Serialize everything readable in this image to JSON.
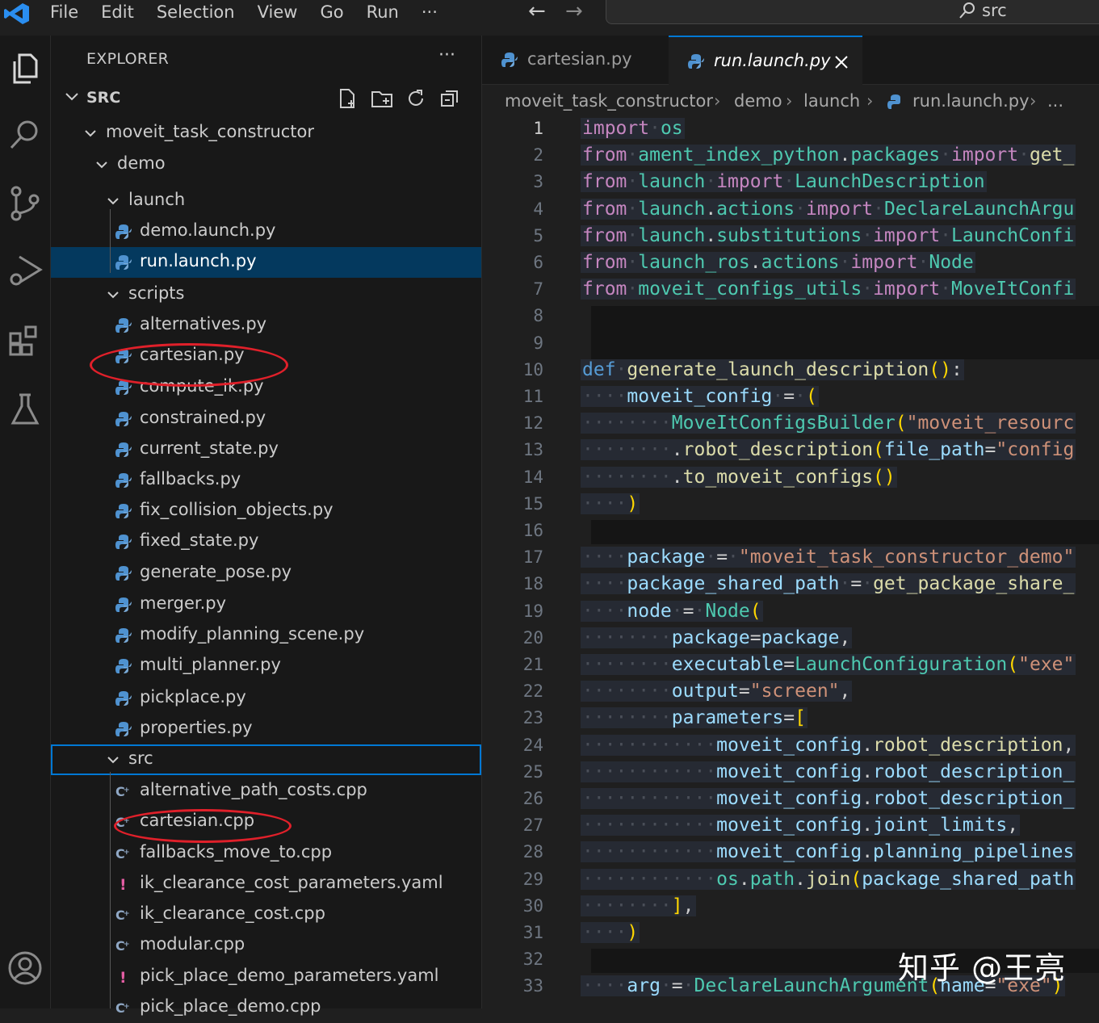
{
  "menu": [
    "File",
    "Edit",
    "Selection",
    "View",
    "Go",
    "Run",
    "···"
  ],
  "command_center": {
    "search_text": "src"
  },
  "activity_icons": [
    "explorer-icon",
    "search-icon",
    "source-control-icon",
    "run-debug-icon",
    "extensions-icon",
    "testing-icon",
    "accounts-icon"
  ],
  "explorer": {
    "title": "EXPLORER",
    "more": "···",
    "root": "SRC",
    "tree": [
      {
        "label": "moveit_task_constructor",
        "type": "folder"
      },
      {
        "label": "demo",
        "type": "folder"
      },
      {
        "label": "launch",
        "type": "folder"
      },
      {
        "label": "demo.launch.py",
        "type": "py"
      },
      {
        "label": "run.launch.py",
        "type": "py",
        "selected": true
      },
      {
        "label": "scripts",
        "type": "folder"
      },
      {
        "label": "alternatives.py",
        "type": "py"
      },
      {
        "label": "cartesian.py",
        "type": "py",
        "circled": true
      },
      {
        "label": "compute_ik.py",
        "type": "py"
      },
      {
        "label": "constrained.py",
        "type": "py"
      },
      {
        "label": "current_state.py",
        "type": "py"
      },
      {
        "label": "fallbacks.py",
        "type": "py"
      },
      {
        "label": "fix_collision_objects.py",
        "type": "py"
      },
      {
        "label": "fixed_state.py",
        "type": "py"
      },
      {
        "label": "generate_pose.py",
        "type": "py"
      },
      {
        "label": "merger.py",
        "type": "py"
      },
      {
        "label": "modify_planning_scene.py",
        "type": "py"
      },
      {
        "label": "multi_planner.py",
        "type": "py"
      },
      {
        "label": "pickplace.py",
        "type": "py"
      },
      {
        "label": "properties.py",
        "type": "py"
      },
      {
        "label": "src",
        "type": "folder",
        "focused": true
      },
      {
        "label": "alternative_path_costs.cpp",
        "type": "cpp"
      },
      {
        "label": "cartesian.cpp",
        "type": "cpp",
        "circled": true
      },
      {
        "label": "fallbacks_move_to.cpp",
        "type": "cpp"
      },
      {
        "label": "ik_clearance_cost_parameters.yaml",
        "type": "yaml"
      },
      {
        "label": "ik_clearance_cost.cpp",
        "type": "cpp"
      },
      {
        "label": "modular.cpp",
        "type": "cpp"
      },
      {
        "label": "pick_place_demo_parameters.yaml",
        "type": "yaml"
      },
      {
        "label": "pick_place_demo.cpp",
        "type": "cpp"
      }
    ]
  },
  "tabs": [
    {
      "label": "cartesian.py",
      "active": false
    },
    {
      "label": "run.launch.py",
      "active": true
    }
  ],
  "breadcrumb": [
    "moveit_task_constructor",
    "demo",
    "launch",
    "run.launch.py",
    "..."
  ],
  "editor": {
    "line_numbers": [
      "1",
      "2",
      "3",
      "4",
      "5",
      "6",
      "7",
      "8",
      "9",
      "10",
      "11",
      "12",
      "13",
      "14",
      "15",
      "16",
      "17",
      "18",
      "19",
      "20",
      "21",
      "22",
      "23",
      "24",
      "25",
      "26",
      "27",
      "28",
      "29",
      "30",
      "31",
      "32",
      "33"
    ],
    "lines": [
      "import os",
      "from ament_index_python.packages import get_",
      "from launch import LaunchDescription",
      "from launch.actions import DeclareLaunchArgu",
      "from launch.substitutions import LaunchConfi",
      "from launch_ros.actions import Node",
      "from moveit_configs_utils import MoveItConfi",
      "",
      "",
      "def generate_launch_description():",
      "    moveit_config = (",
      "        MoveItConfigsBuilder(\"moveit_resourc",
      "        .robot_description(file_path=\"config",
      "        .to_moveit_configs()",
      "    )",
      "",
      "    package = \"moveit_task_constructor_demo\"",
      "    package_shared_path = get_package_share_",
      "    node = Node(",
      "        package=package,",
      "        executable=LaunchConfiguration(\"exe\"",
      "        output=\"screen\",",
      "        parameters=[",
      "            moveit_config.robot_description,",
      "            moveit_config.robot_description_",
      "            moveit_config.robot_description_",
      "            moveit_config.joint_limits,",
      "            moveit_config.planning_pipelines",
      "            os.path.join(package_shared_path",
      "        ],",
      "    )",
      "",
      "    arg = DeclareLaunchArgument(name=\"exe\")"
    ]
  },
  "watermark": "知乎 @王亮"
}
